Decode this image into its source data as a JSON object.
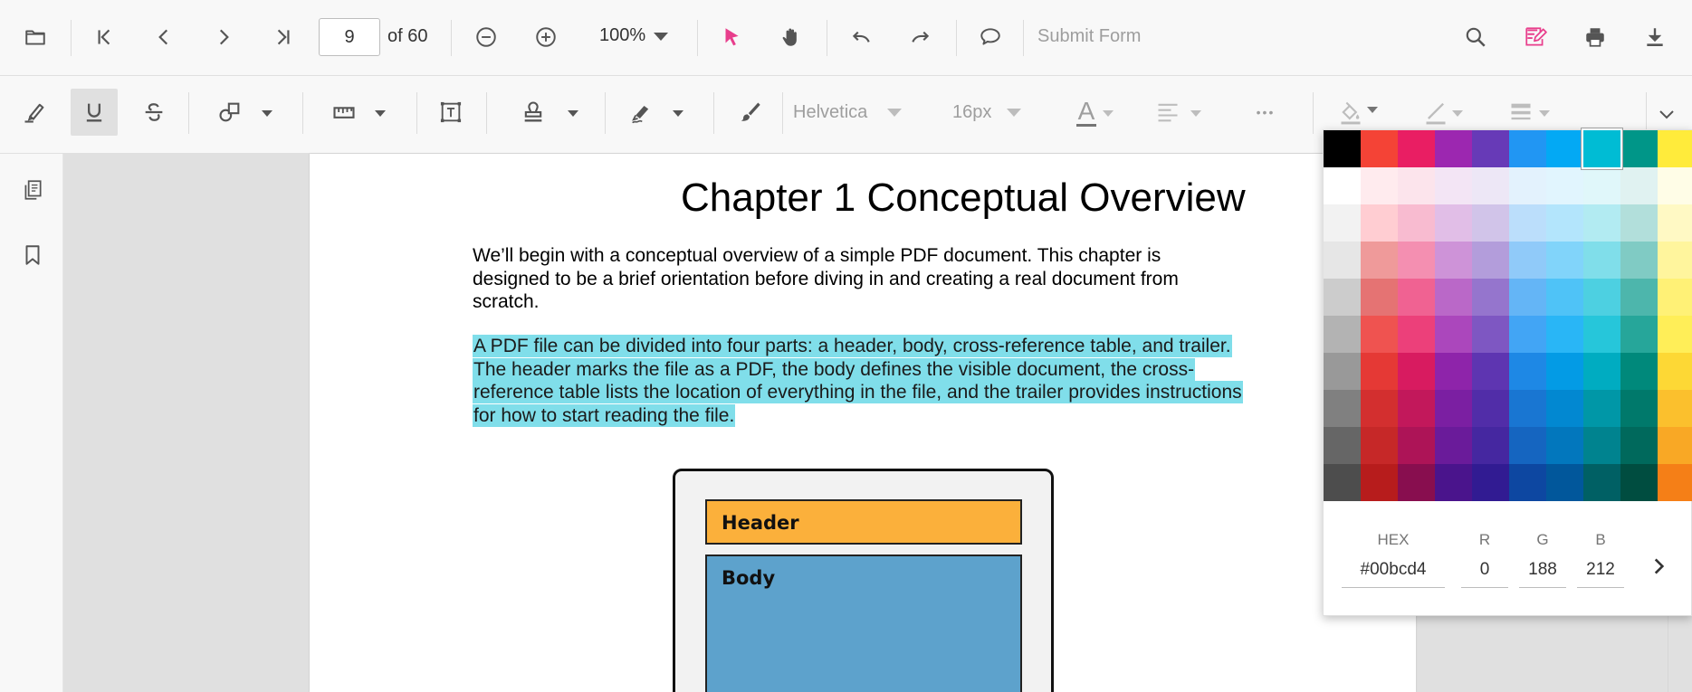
{
  "toolbar": {
    "open_icon": "folder-icon",
    "current_page": "9",
    "page_count_label": "of 60",
    "zoom_level": "100%",
    "submit_form_label": "Submit Form"
  },
  "annotation_toolbar": {
    "font_name": "Helvetica",
    "font_size": "16px",
    "font_color_glyph": "A",
    "more_glyph": "•••"
  },
  "document": {
    "chapter_title": "Chapter 1  Conceptual Overview",
    "paragraph_1": "We’ll begin with a conceptual overview of a simple PDF document. This chapter is designed to be a brief orientation before diving in and creating a real document from scratch.",
    "paragraph_2": "A PDF file can be divided into four parts: a header, body, cross-reference table, and trailer. The header marks the file as a PDF, the body defines the visible document, the cross-reference table lists the location of everything in the file, and the trailer provides instructions for how to start reading the file.",
    "highlight_color": "#80deea",
    "diagram": {
      "header_label": "Header",
      "body_label": "Body",
      "header_color": "#fbb03b",
      "body_color": "#5da2cc"
    }
  },
  "color_picker": {
    "hex_label": "HEX",
    "r_label": "R",
    "g_label": "G",
    "b_label": "B",
    "hex_value": "#00bcd4",
    "r_value": "0",
    "g_value": "188",
    "b_value": "212",
    "selected_color": "#00bcd4",
    "palette": [
      [
        "#000000",
        "#f44336",
        "#e91e63",
        "#9c27b0",
        "#673ab7",
        "#2196f3",
        "#03a9f4",
        "#00bcd4",
        "#009688",
        "#ffeb3b"
      ],
      [
        "#ffffff",
        "#ffebee",
        "#fce4ec",
        "#f3e5f5",
        "#ede7f6",
        "#e3f2fd",
        "#e1f5fe",
        "#e0f7fa",
        "#e0f2f1",
        "#fffde7"
      ],
      [
        "#f2f2f2",
        "#ffcdd2",
        "#f8bbd0",
        "#e1bee7",
        "#d1c4e9",
        "#bbdefb",
        "#b3e5fc",
        "#b2ebf2",
        "#b2dfdb",
        "#fff9c4"
      ],
      [
        "#e6e6e6",
        "#ef9a9a",
        "#f48fb1",
        "#ce93d8",
        "#b39ddb",
        "#90caf9",
        "#81d4fa",
        "#80deea",
        "#80cbc4",
        "#fff59d"
      ],
      [
        "#cccccc",
        "#e57373",
        "#f06292",
        "#ba68c8",
        "#9575cd",
        "#64b5f6",
        "#4fc3f7",
        "#4dd0e1",
        "#4db6ac",
        "#fff176"
      ],
      [
        "#b3b3b3",
        "#ef5350",
        "#ec407a",
        "#ab47bc",
        "#7e57c2",
        "#42a5f5",
        "#29b6f6",
        "#26c6da",
        "#26a69a",
        "#ffee58"
      ],
      [
        "#999999",
        "#e53935",
        "#d81b60",
        "#8e24aa",
        "#5e35b1",
        "#1e88e5",
        "#039be5",
        "#00acc1",
        "#00897b",
        "#fdd835"
      ],
      [
        "#808080",
        "#d32f2f",
        "#c2185b",
        "#7b1fa2",
        "#512da8",
        "#1976d2",
        "#0288d1",
        "#0097a7",
        "#00796b",
        "#fbc02d"
      ],
      [
        "#666666",
        "#c62828",
        "#ad1457",
        "#6a1b9a",
        "#4527a0",
        "#1565c0",
        "#0277bd",
        "#00838f",
        "#00695c",
        "#f9a825"
      ],
      [
        "#4d4d4d",
        "#b71c1c",
        "#880e4f",
        "#4a148c",
        "#311b92",
        "#0d47a1",
        "#01579b",
        "#006064",
        "#004d40",
        "#f57f17"
      ]
    ]
  },
  "colors": {
    "accent_pink": "#e83e8c",
    "icon_gray": "#555555",
    "muted_gray": "#9e9e9e"
  }
}
